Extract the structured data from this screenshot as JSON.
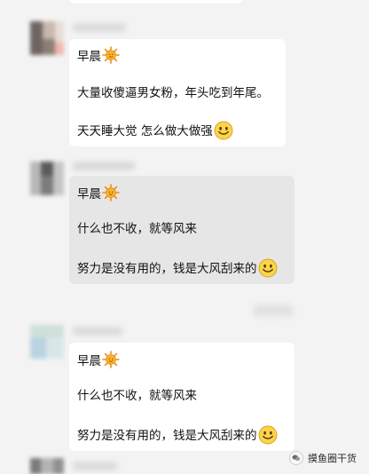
{
  "messages": [
    {
      "greeting": "早晨",
      "line1": "大量收傻逼男女粉，年头吃到年尾。",
      "line2": "天天睡大觉 怎么做大做强"
    },
    {
      "greeting": "早晨",
      "line1": "什么也不收，就等风来",
      "line2": "努力是没有用的，钱是大风刮来的"
    },
    {
      "greeting": "早晨",
      "line1": "什么也不收，就等风来",
      "line2": "努力是没有用的，钱是大风刮来的"
    }
  ],
  "watermark": {
    "text": "摸鱼圈干货"
  },
  "icons": {
    "sun": "sun-emoji-icon",
    "smile": "smile-emoji-icon",
    "watermark_logo": "wechat-logo-icon"
  },
  "colors": {
    "background": "#f3f3f3",
    "bubble": "#ffffff",
    "bubble_selected": "#e6e6e6"
  }
}
